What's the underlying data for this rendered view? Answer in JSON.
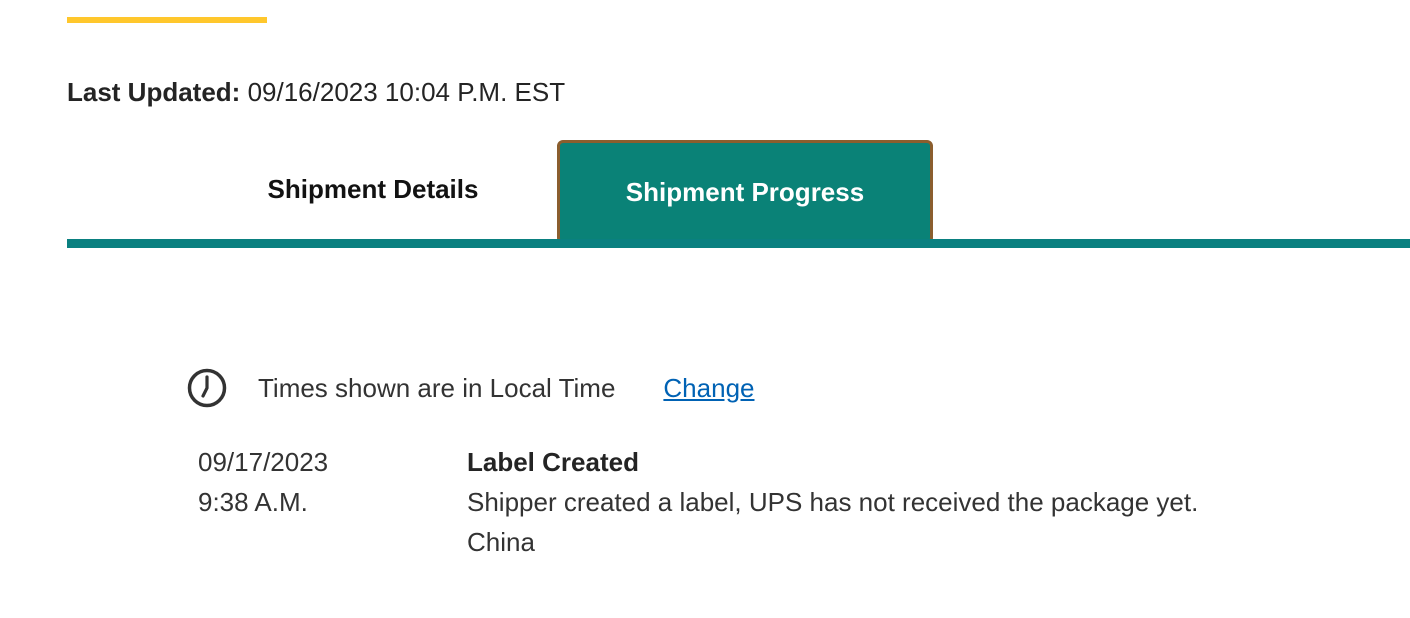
{
  "header": {
    "last_updated_label": "Last Updated:",
    "last_updated_value": "09/16/2023 10:04 P.M. EST"
  },
  "tabs": [
    {
      "label": "Shipment Details",
      "selected": false
    },
    {
      "label": "Shipment Progress",
      "selected": true
    }
  ],
  "timezone": {
    "icon": "clock-icon",
    "text": "Times shown are in Local Time",
    "change_label": "Change"
  },
  "events": [
    {
      "date": "09/17/2023",
      "time": "9:38 A.M.",
      "status": "Label Created",
      "description": "Shipper created a label, UPS has not received the package yet.",
      "location": "China"
    }
  ],
  "colors": {
    "accent": "#ffc72c",
    "tab_active_bg": "#0a8277",
    "tab_active_border": "#8b5e2e",
    "link": "#0062b4"
  }
}
